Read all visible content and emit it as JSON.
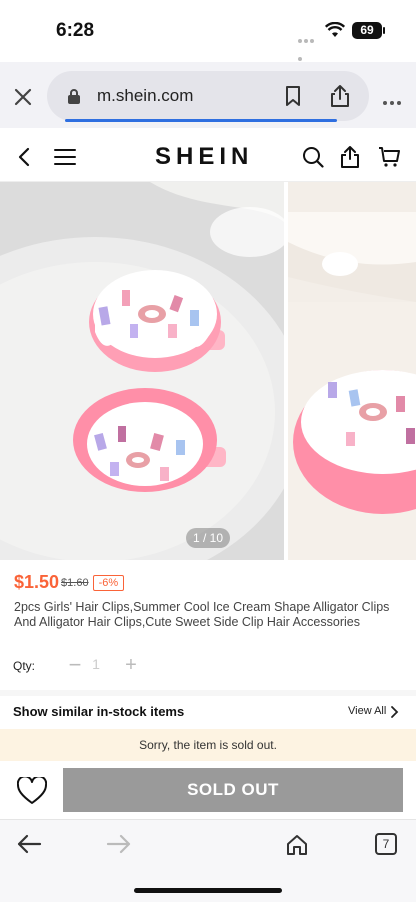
{
  "status_bar": {
    "time": "6:28",
    "battery": "69"
  },
  "browser": {
    "url": "m.shein.com",
    "tab_count": "7"
  },
  "site": {
    "logo": "SHEIN"
  },
  "gallery": {
    "counter": "1 / 10"
  },
  "product": {
    "price": "$1.50",
    "original_price": "$1.60",
    "discount": "-6%",
    "title": "2pcs Girls' Hair Clips,Summer Cool Ice Cream Shape Alligator Clips And Alligator Hair Clips,Cute Sweet Side Clip Hair Accessories",
    "qty_label": "Qty:",
    "qty_value": "1",
    "qty_minus": "−",
    "qty_plus": "+"
  },
  "similar": {
    "label": "Show similar in-stock items",
    "view_all": "View All"
  },
  "notice": "Sorry, the item is sold out.",
  "action": {
    "sold_out": "SOLD OUT"
  },
  "colors": {
    "price": "#fa6338",
    "notice_bg": "#fdf3e2",
    "sold_out_bg": "#9a9a9a",
    "link_blue": "#2f6fe0"
  }
}
